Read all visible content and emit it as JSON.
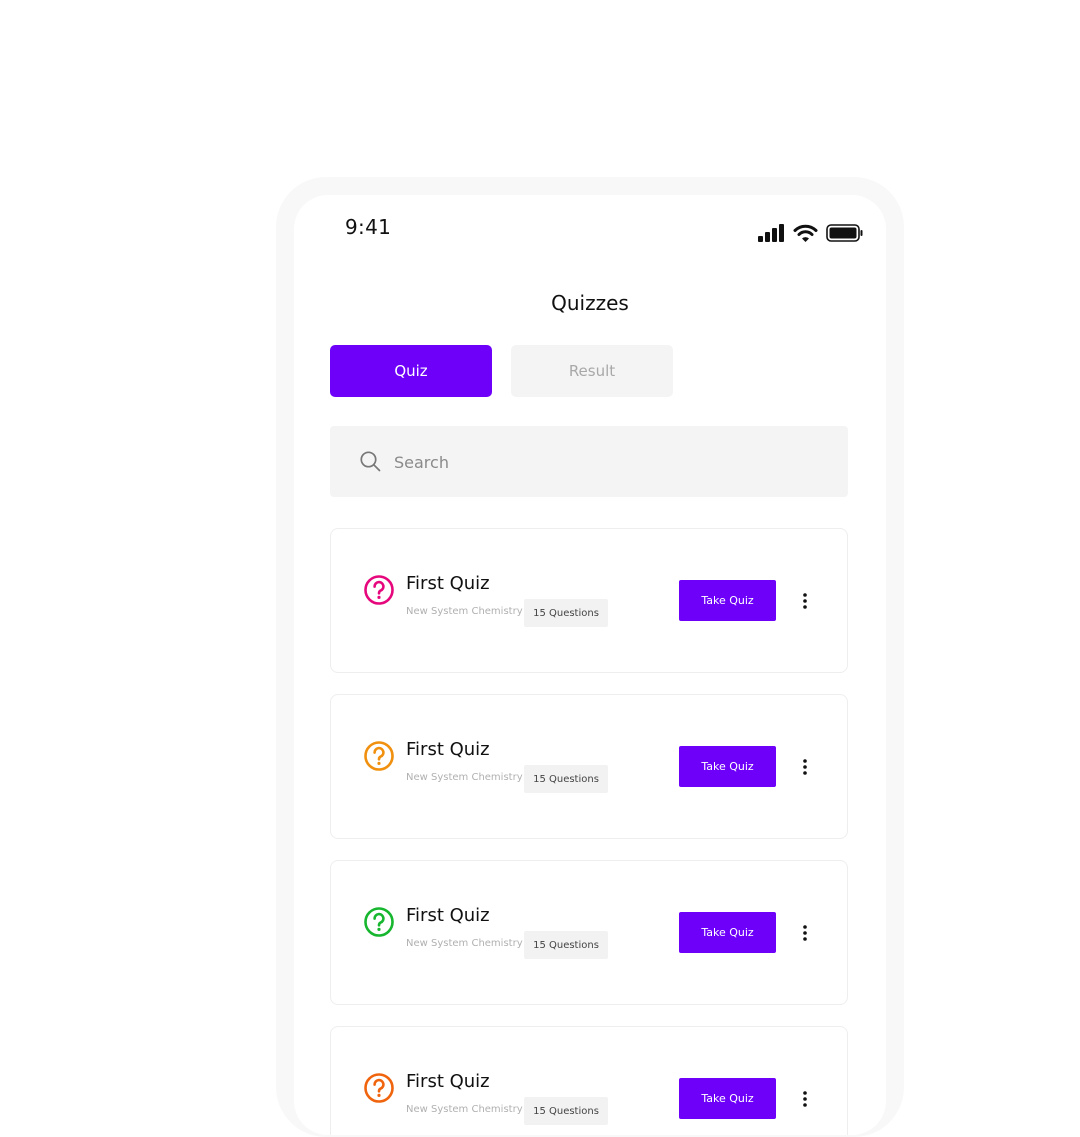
{
  "status_bar": {
    "time": "9:41",
    "icons": [
      "cellular-signal-icon",
      "wifi-icon",
      "battery-icon"
    ]
  },
  "header": {
    "title": "Quizzes"
  },
  "tabs": [
    {
      "label": "Quiz",
      "active": true
    },
    {
      "label": "Result",
      "active": false
    }
  ],
  "search": {
    "placeholder": "Search",
    "value": ""
  },
  "quizzes": [
    {
      "title": "First Quiz",
      "subject": "New System Chemistry",
      "count": "15 Questions",
      "button": "Take Quiz",
      "icon": "question-circle-icon",
      "icon_color": "#e6077d"
    },
    {
      "title": "First Quiz",
      "subject": "New System Chemistry",
      "count": "15 Questions",
      "button": "Take Quiz",
      "icon": "question-circle-icon",
      "icon_color": "#f0900e"
    },
    {
      "title": "First Quiz",
      "subject": "New System Chemistry",
      "count": "15 Questions",
      "button": "Take Quiz",
      "icon": "question-circle-icon",
      "icon_color": "#16b62e"
    },
    {
      "title": "First Quiz",
      "subject": "New System Chemistry",
      "count": "15 Questions",
      "button": "Take Quiz",
      "icon": "question-circle-icon",
      "icon_color": "#f0640e"
    }
  ],
  "colors": {
    "accent": "#6e00fa",
    "tab_inactive_bg": "#f4f4f4",
    "tab_inactive_text": "#a8a8a8"
  }
}
